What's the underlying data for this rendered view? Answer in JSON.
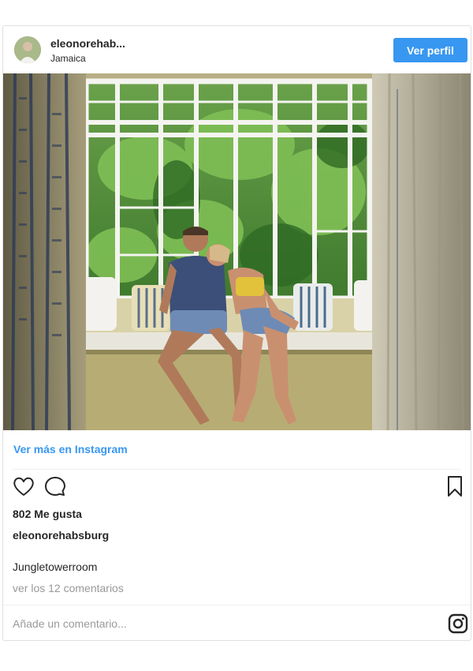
{
  "post": {
    "username": "eleonorehab...",
    "location": "Jamaica",
    "profile_button": "Ver perfil",
    "view_more": "Ver más en Instagram",
    "likes": "802 Me gusta",
    "caption_user": "eleonorehabsburg",
    "caption": "Jungletowerroom",
    "comments_link": "ver los 12 comentarios",
    "comment_placeholder": "Añade un comentario..."
  },
  "icons": {
    "like": "heart-icon",
    "comment": "comment-bubble-icon",
    "save": "bookmark-icon",
    "brand": "instagram-icon"
  },
  "colors": {
    "accent": "#3897f0",
    "text": "#262626",
    "muted": "#999999"
  }
}
